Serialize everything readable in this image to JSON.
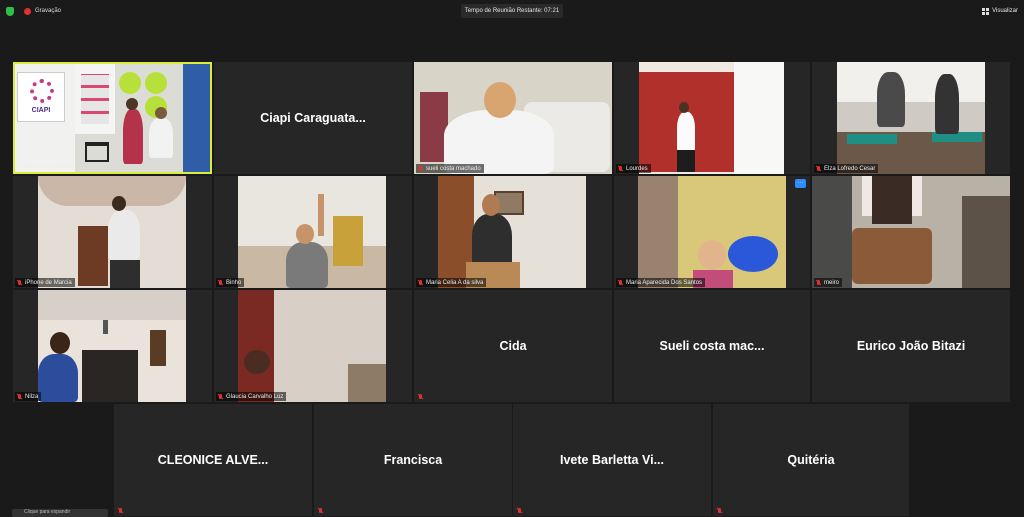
{
  "topbar": {
    "recording_label": "Gravação",
    "timer_text": "Tempo de Reunião Restante: 07:21",
    "view_label": "Visualizar"
  },
  "tiles": {
    "t1": "Ciapi Caraguatatuba",
    "t2_big": "Ciapi Caraguata...",
    "t3": "sueli costa machado",
    "t4": "Lourdes",
    "t5": "Elza Lofredo Cesar",
    "t6": "iPhone de Marcia",
    "t7": "Binho",
    "t8": "Maria Celia A da silva",
    "t9": "Maria Aparecida Dos Santos",
    "t10": "meiro",
    "t11": "Nilza",
    "t12": "Glaucia Carvalho Luz",
    "t13_big": "Cida",
    "t14_big": "Sueli costa mac...",
    "t15_big": "Eurico João Bitazi",
    "t16_big": "CLEONICE ALVE...",
    "t17_big": "Francisca",
    "t18_big": "Ivete Barletta Vi...",
    "t19_big": "Quitéria"
  },
  "logo_text": "CIAPI",
  "more_icon": "···",
  "footer_hint": "Clique para expandir"
}
